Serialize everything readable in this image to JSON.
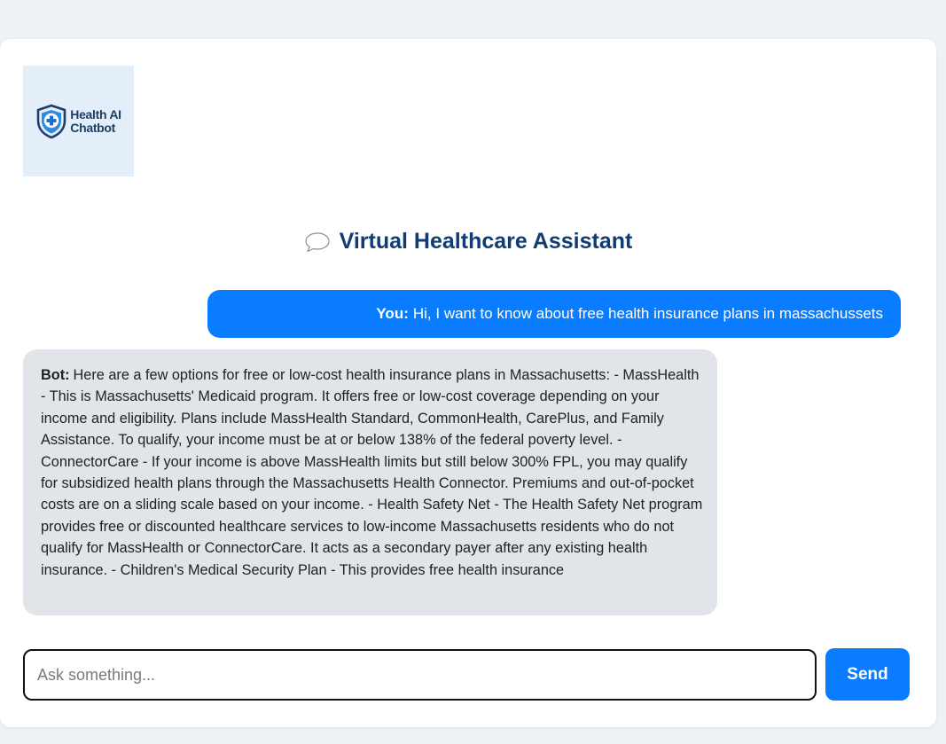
{
  "logo": {
    "line1": "Health AI",
    "line2": "Chatbot",
    "icon": "shield-plus-icon",
    "bg_color": "#e3eef9",
    "text_color": "#1d3e66"
  },
  "header": {
    "title": "Virtual Healthcare Assistant",
    "icon": "speech-bubble-icon",
    "title_color": "#103c73"
  },
  "messages": [
    {
      "sender_label": "You:",
      "text": "Hi, I want to know about free health insurance plans in massachussets",
      "role": "user",
      "bg_color": "#0a7cff"
    },
    {
      "sender_label": "Bot:",
      "text": "Here are a few options for free or low-cost health insurance plans in Massachusetts: - MassHealth - This is Massachusetts' Medicaid program. It offers free or low-cost coverage depending on your income and eligibility. Plans include MassHealth Standard, CommonHealth, CarePlus, and Family Assistance. To qualify, your income must be at or below 138% of the federal poverty level. - ConnectorCare - If your income is above MassHealth limits but still below 300% FPL, you may qualify for subsidized health plans through the Massachusetts Health Connector. Premiums and out-of-pocket costs are on a sliding scale based on your income. - Health Safety Net - The Health Safety Net program provides free or discounted healthcare services to low-income Massachusetts residents who do not qualify for MassHealth or ConnectorCare. It acts as a secondary payer after any existing health insurance. - Children's Medical Security Plan - This provides free health insurance",
      "role": "bot",
      "bg_color": "#e1e4e8"
    }
  ],
  "composer": {
    "value": "",
    "placeholder": "Ask something...",
    "send_label": "Send",
    "accent_color": "#0a7cff"
  }
}
